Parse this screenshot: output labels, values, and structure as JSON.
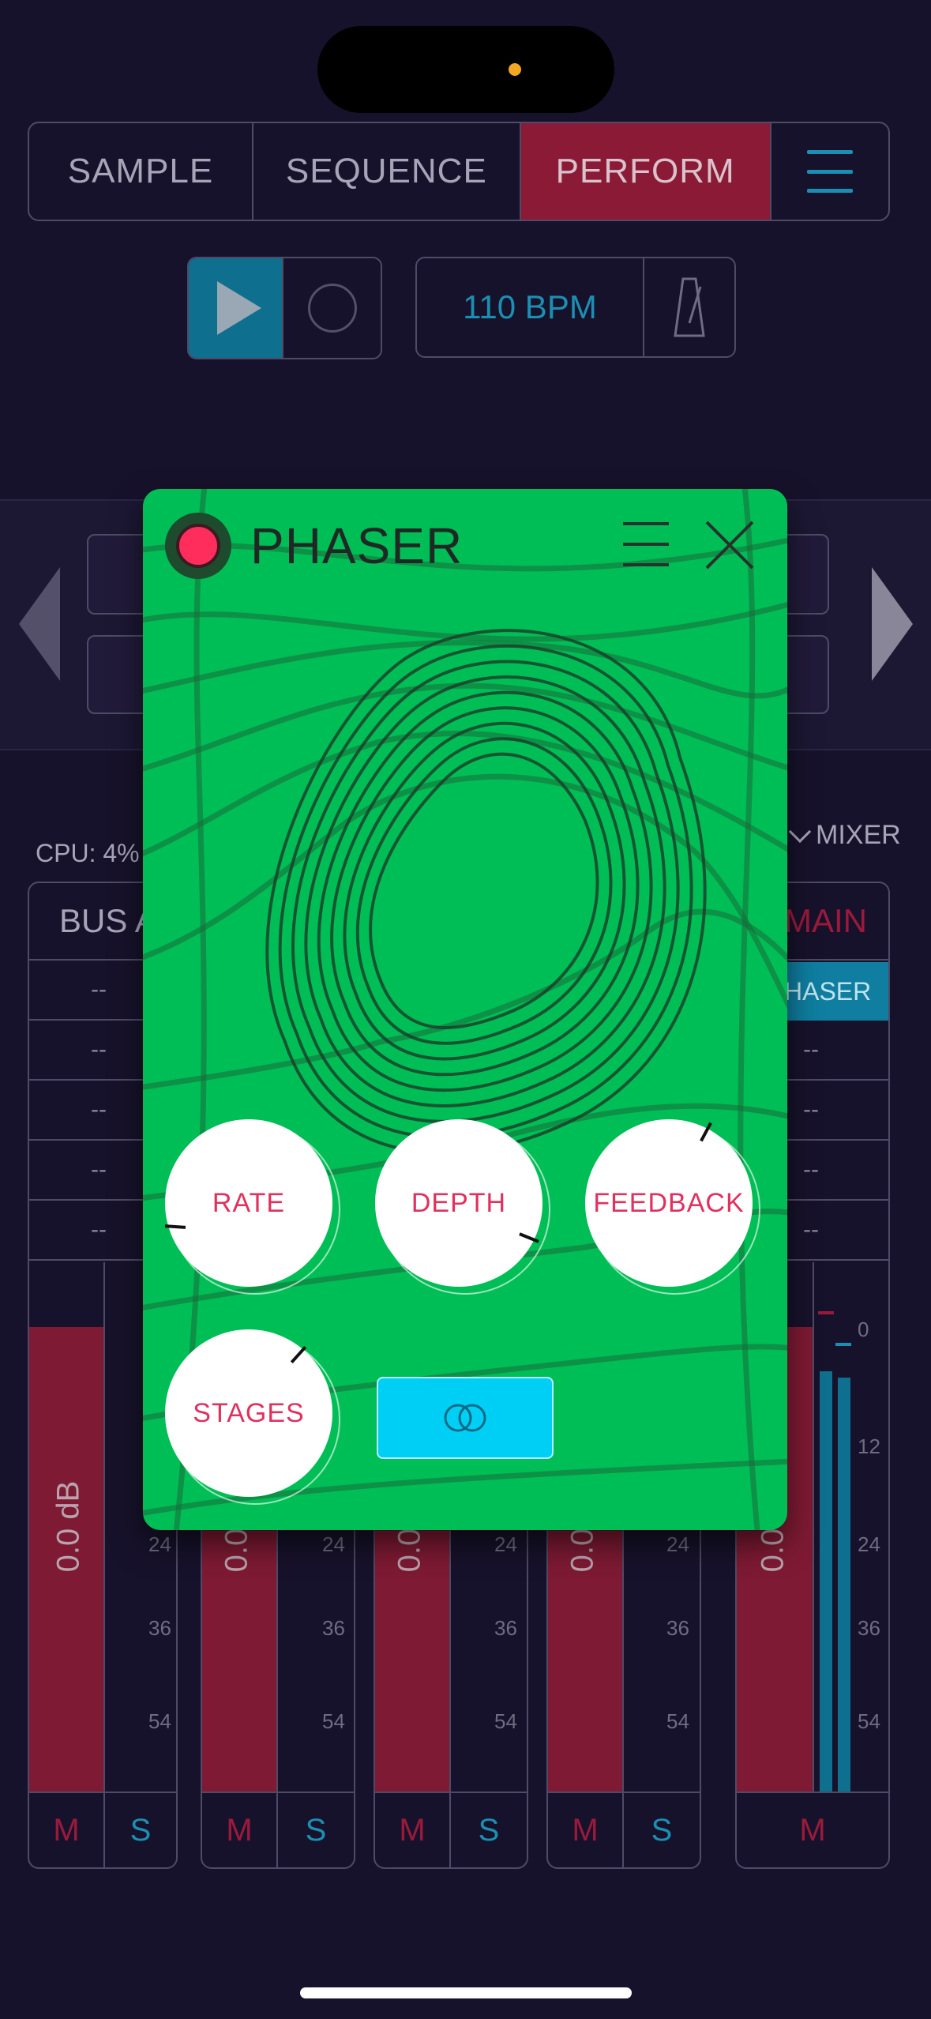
{
  "tabs": [
    {
      "label": "SAMPLE"
    },
    {
      "label": "SEQUENCE"
    },
    {
      "label": "PERFORM",
      "active": true
    }
  ],
  "transport": {
    "bpm_label": "110 BPM"
  },
  "status": {
    "cpu": "CPU: 4%",
    "mixer_label": "MIXER"
  },
  "channels": [
    {
      "name": "BUS A",
      "slots": [
        "--",
        "--",
        "--",
        "--",
        "--"
      ],
      "level": "0.0 dB",
      "mute": "M",
      "solo": "S"
    },
    {
      "name": "",
      "level": "0.0",
      "mute": "M",
      "solo": "S"
    },
    {
      "name": "",
      "level": "0.0",
      "mute": "M",
      "solo": "S"
    },
    {
      "name": "",
      "level": "0.0",
      "mute": "M",
      "solo": "S"
    },
    {
      "name": "MAIN",
      "slots": [
        "HASER",
        "--",
        "--",
        "--",
        "--"
      ],
      "level": "0.0",
      "mute": "M"
    }
  ],
  "scale": [
    "24",
    "36",
    "54"
  ],
  "main_scale": [
    "0",
    "12",
    "24",
    "36",
    "54"
  ],
  "phaser": {
    "title": "PHASER",
    "power": "on",
    "knobs": [
      {
        "label": "RATE",
        "level": 0.07
      },
      {
        "label": "DEPTH",
        "level": 0.55
      },
      {
        "label": "FEEDBACK",
        "level": 0.75
      },
      {
        "label": "STAGES",
        "level": 0.8
      }
    ],
    "stereo_icon": "stereo-link-icon"
  },
  "colors": {
    "background": "#17122b",
    "accent_red": "#8a1a36",
    "accent_blue": "#1b8fb3",
    "phaser_green": "#00be56",
    "knob_label": "#e0315e"
  }
}
